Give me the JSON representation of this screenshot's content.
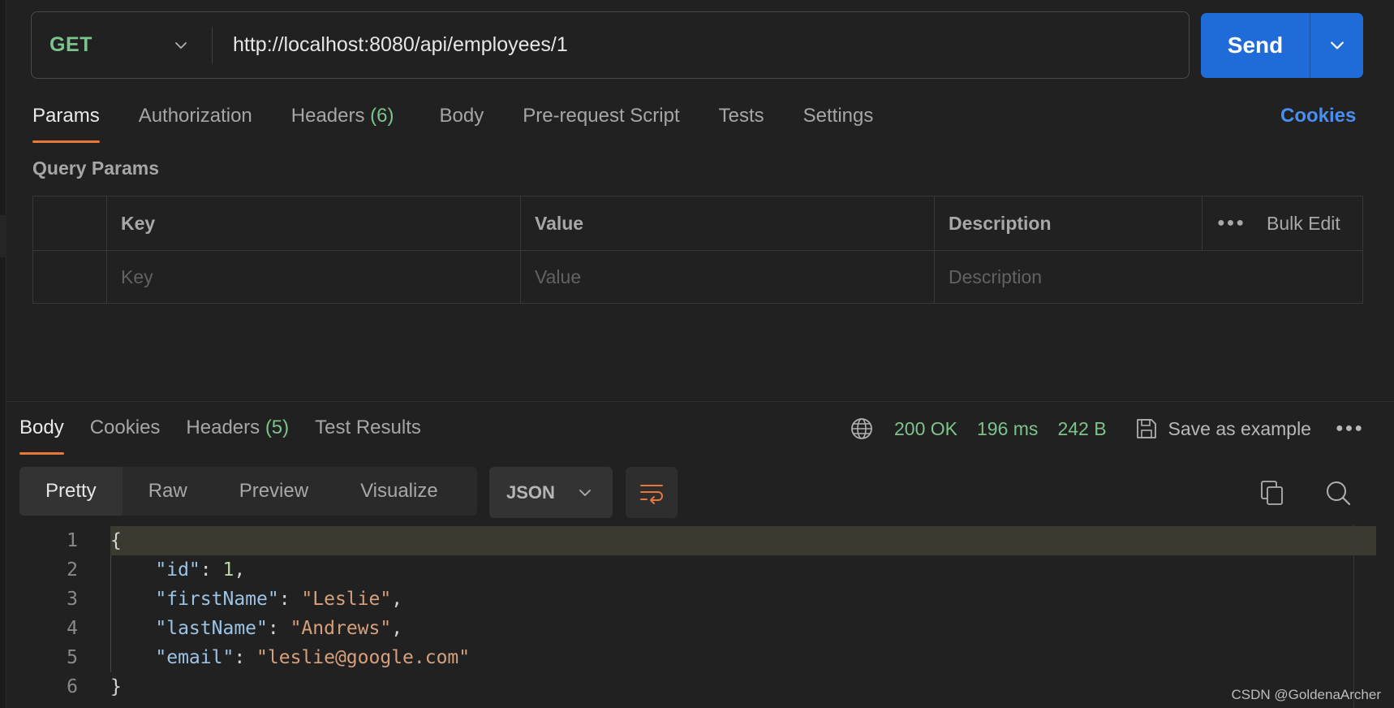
{
  "request": {
    "method": "GET",
    "url": "http://localhost:8080/api/employees/1",
    "send_label": "Send"
  },
  "request_tabs": {
    "params": "Params",
    "authorization": "Authorization",
    "headers": "Headers",
    "headers_count": "(6)",
    "body": "Body",
    "prerequest": "Pre-request Script",
    "tests": "Tests",
    "settings": "Settings",
    "cookies": "Cookies"
  },
  "query_params": {
    "title": "Query Params",
    "col_key": "Key",
    "col_value": "Value",
    "col_description": "Description",
    "bulk_edit": "Bulk Edit",
    "key_placeholder": "Key",
    "value_placeholder": "Value",
    "description_placeholder": "Description"
  },
  "response_tabs": {
    "body": "Body",
    "cookies": "Cookies",
    "headers": "Headers",
    "headers_count": "(5)",
    "test_results": "Test Results"
  },
  "response_status": {
    "status": "200 OK",
    "time": "196 ms",
    "size": "242 B",
    "save_label": "Save as example"
  },
  "body_toolbar": {
    "pretty": "Pretty",
    "raw": "Raw",
    "preview": "Preview",
    "visualize": "Visualize",
    "format": "JSON"
  },
  "code": {
    "line_numbers": [
      "1",
      "2",
      "3",
      "4",
      "5",
      "6"
    ],
    "open_brace": "{",
    "close_brace": "}",
    "id_key": "\"id\"",
    "id_value": "1",
    "first_key": "\"firstName\"",
    "first_value": "\"Leslie\"",
    "last_key": "\"lastName\"",
    "last_value": "\"Andrews\"",
    "email_key": "\"email\"",
    "email_value": "\"leslie@google.com\""
  },
  "watermark": "CSDN @GoldenaArcher",
  "colors": {
    "accent_blue": "#1f6bd8",
    "success_green": "#7cc38d",
    "tab_underline": "#e8773a",
    "link_blue": "#4a8eef"
  },
  "icons": [
    "chevron-down-icon",
    "globe-icon",
    "save-icon",
    "more-icon",
    "wrap-lines-icon",
    "copy-icon",
    "search-icon"
  ]
}
